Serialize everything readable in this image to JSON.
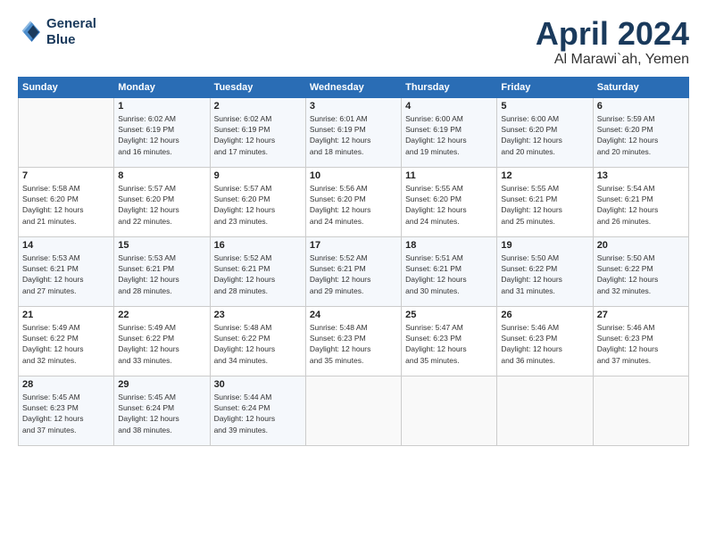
{
  "header": {
    "logo_line1": "General",
    "logo_line2": "Blue",
    "month": "April 2024",
    "location": "Al Marawi`ah, Yemen"
  },
  "days_of_week": [
    "Sunday",
    "Monday",
    "Tuesday",
    "Wednesday",
    "Thursday",
    "Friday",
    "Saturday"
  ],
  "weeks": [
    [
      {
        "day": "",
        "info": ""
      },
      {
        "day": "1",
        "info": "Sunrise: 6:02 AM\nSunset: 6:19 PM\nDaylight: 12 hours\nand 16 minutes."
      },
      {
        "day": "2",
        "info": "Sunrise: 6:02 AM\nSunset: 6:19 PM\nDaylight: 12 hours\nand 17 minutes."
      },
      {
        "day": "3",
        "info": "Sunrise: 6:01 AM\nSunset: 6:19 PM\nDaylight: 12 hours\nand 18 minutes."
      },
      {
        "day": "4",
        "info": "Sunrise: 6:00 AM\nSunset: 6:19 PM\nDaylight: 12 hours\nand 19 minutes."
      },
      {
        "day": "5",
        "info": "Sunrise: 6:00 AM\nSunset: 6:20 PM\nDaylight: 12 hours\nand 20 minutes."
      },
      {
        "day": "6",
        "info": "Sunrise: 5:59 AM\nSunset: 6:20 PM\nDaylight: 12 hours\nand 20 minutes."
      }
    ],
    [
      {
        "day": "7",
        "info": "Sunrise: 5:58 AM\nSunset: 6:20 PM\nDaylight: 12 hours\nand 21 minutes."
      },
      {
        "day": "8",
        "info": "Sunrise: 5:57 AM\nSunset: 6:20 PM\nDaylight: 12 hours\nand 22 minutes."
      },
      {
        "day": "9",
        "info": "Sunrise: 5:57 AM\nSunset: 6:20 PM\nDaylight: 12 hours\nand 23 minutes."
      },
      {
        "day": "10",
        "info": "Sunrise: 5:56 AM\nSunset: 6:20 PM\nDaylight: 12 hours\nand 24 minutes."
      },
      {
        "day": "11",
        "info": "Sunrise: 5:55 AM\nSunset: 6:20 PM\nDaylight: 12 hours\nand 24 minutes."
      },
      {
        "day": "12",
        "info": "Sunrise: 5:55 AM\nSunset: 6:21 PM\nDaylight: 12 hours\nand 25 minutes."
      },
      {
        "day": "13",
        "info": "Sunrise: 5:54 AM\nSunset: 6:21 PM\nDaylight: 12 hours\nand 26 minutes."
      }
    ],
    [
      {
        "day": "14",
        "info": "Sunrise: 5:53 AM\nSunset: 6:21 PM\nDaylight: 12 hours\nand 27 minutes."
      },
      {
        "day": "15",
        "info": "Sunrise: 5:53 AM\nSunset: 6:21 PM\nDaylight: 12 hours\nand 28 minutes."
      },
      {
        "day": "16",
        "info": "Sunrise: 5:52 AM\nSunset: 6:21 PM\nDaylight: 12 hours\nand 28 minutes."
      },
      {
        "day": "17",
        "info": "Sunrise: 5:52 AM\nSunset: 6:21 PM\nDaylight: 12 hours\nand 29 minutes."
      },
      {
        "day": "18",
        "info": "Sunrise: 5:51 AM\nSunset: 6:21 PM\nDaylight: 12 hours\nand 30 minutes."
      },
      {
        "day": "19",
        "info": "Sunrise: 5:50 AM\nSunset: 6:22 PM\nDaylight: 12 hours\nand 31 minutes."
      },
      {
        "day": "20",
        "info": "Sunrise: 5:50 AM\nSunset: 6:22 PM\nDaylight: 12 hours\nand 32 minutes."
      }
    ],
    [
      {
        "day": "21",
        "info": "Sunrise: 5:49 AM\nSunset: 6:22 PM\nDaylight: 12 hours\nand 32 minutes."
      },
      {
        "day": "22",
        "info": "Sunrise: 5:49 AM\nSunset: 6:22 PM\nDaylight: 12 hours\nand 33 minutes."
      },
      {
        "day": "23",
        "info": "Sunrise: 5:48 AM\nSunset: 6:22 PM\nDaylight: 12 hours\nand 34 minutes."
      },
      {
        "day": "24",
        "info": "Sunrise: 5:48 AM\nSunset: 6:23 PM\nDaylight: 12 hours\nand 35 minutes."
      },
      {
        "day": "25",
        "info": "Sunrise: 5:47 AM\nSunset: 6:23 PM\nDaylight: 12 hours\nand 35 minutes."
      },
      {
        "day": "26",
        "info": "Sunrise: 5:46 AM\nSunset: 6:23 PM\nDaylight: 12 hours\nand 36 minutes."
      },
      {
        "day": "27",
        "info": "Sunrise: 5:46 AM\nSunset: 6:23 PM\nDaylight: 12 hours\nand 37 minutes."
      }
    ],
    [
      {
        "day": "28",
        "info": "Sunrise: 5:45 AM\nSunset: 6:23 PM\nDaylight: 12 hours\nand 37 minutes."
      },
      {
        "day": "29",
        "info": "Sunrise: 5:45 AM\nSunset: 6:24 PM\nDaylight: 12 hours\nand 38 minutes."
      },
      {
        "day": "30",
        "info": "Sunrise: 5:44 AM\nSunset: 6:24 PM\nDaylight: 12 hours\nand 39 minutes."
      },
      {
        "day": "",
        "info": ""
      },
      {
        "day": "",
        "info": ""
      },
      {
        "day": "",
        "info": ""
      },
      {
        "day": "",
        "info": ""
      }
    ]
  ]
}
